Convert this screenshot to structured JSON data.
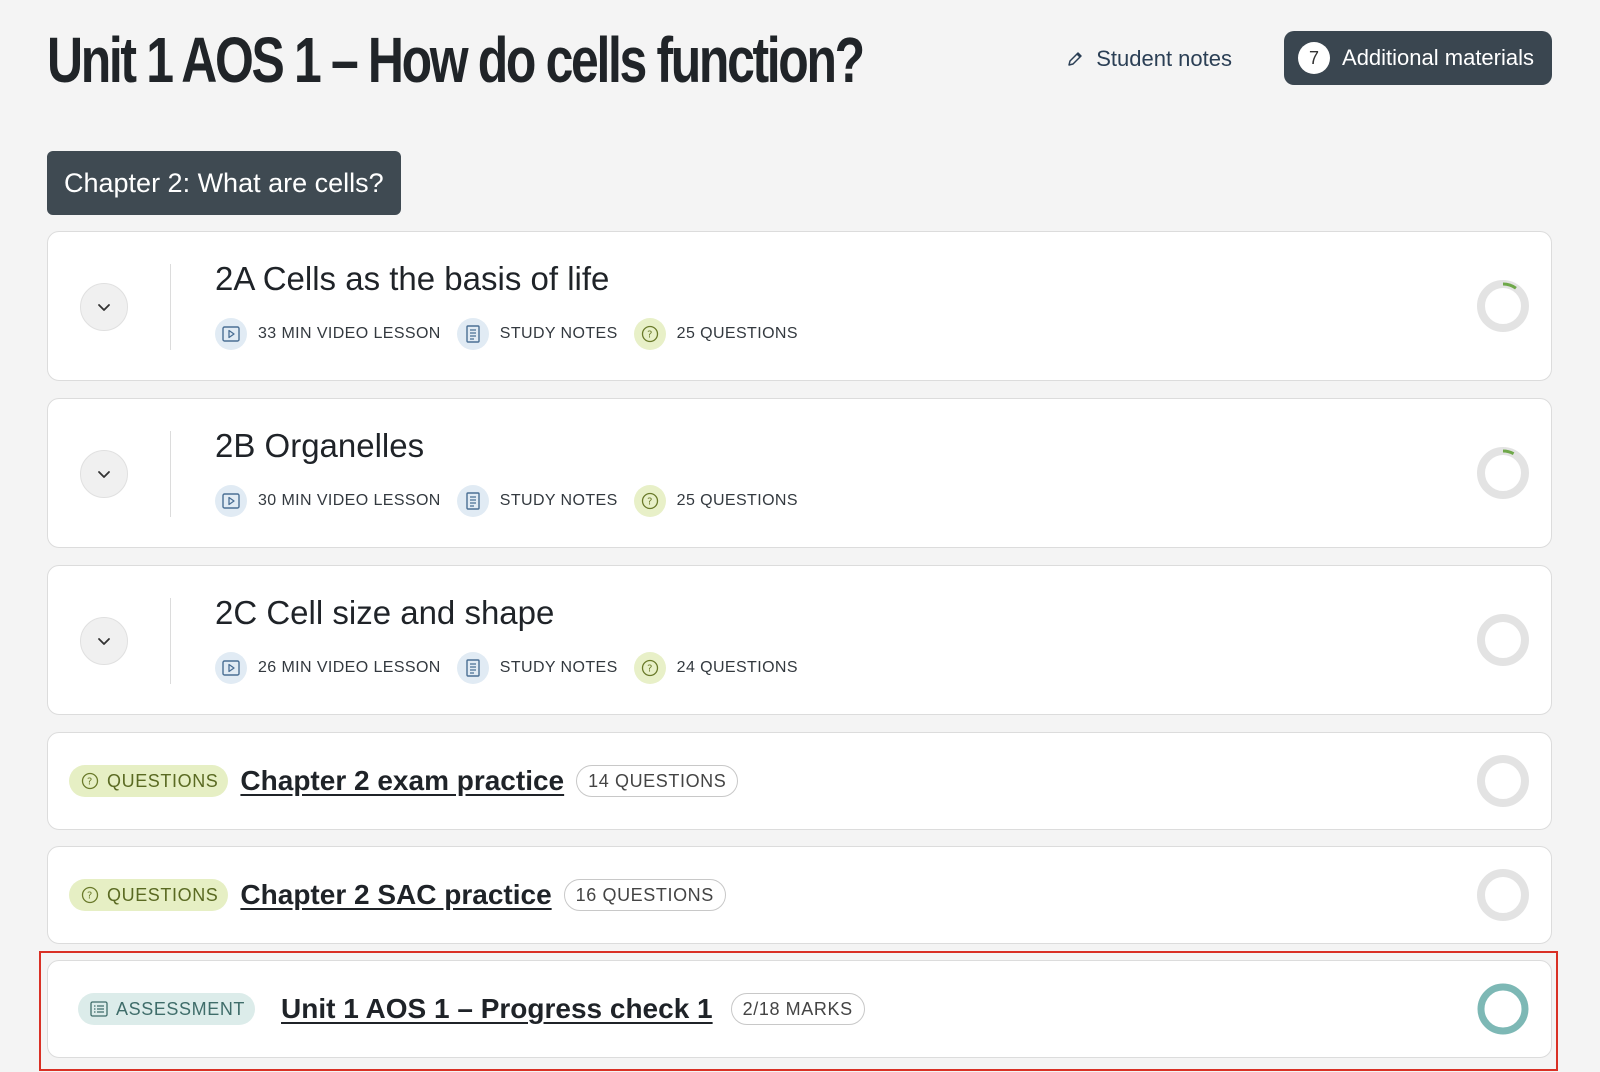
{
  "header": {
    "title": "Unit 1 AOS 1 – How do cells function?",
    "student_notes_label": "Student notes",
    "additional_materials_label": "Additional materials",
    "additional_materials_count": "7"
  },
  "chapter": {
    "label": "Chapter 2: What are cells?"
  },
  "lessons": [
    {
      "title": "2A Cells as the basis of life",
      "video": "33 MIN VIDEO LESSON",
      "notes": "STUDY NOTES",
      "questions": "25 QUESTIONS",
      "progress": 0.1
    },
    {
      "title": "2B Organelles",
      "video": "30 MIN VIDEO LESSON",
      "notes": "STUDY NOTES",
      "questions": "25 QUESTIONS",
      "progress": 0.08
    },
    {
      "title": "2C Cell size and shape",
      "video": "26 MIN VIDEO LESSON",
      "notes": "STUDY NOTES",
      "questions": "24 QUESTIONS",
      "progress": 0
    }
  ],
  "practice": [
    {
      "tag": "QUESTIONS",
      "title": "Chapter 2 exam practice",
      "count": "14 QUESTIONS"
    },
    {
      "tag": "QUESTIONS",
      "title": "Chapter 2 SAC practice",
      "count": "16 QUESTIONS"
    }
  ],
  "assessment": {
    "tag": "ASSESSMENT",
    "title": "Unit 1 AOS 1 – Progress check 1",
    "marks": "2/18 MARKS"
  },
  "colors": {
    "ring_track": "#e3e3e3",
    "ring_progress": "#6fa84a",
    "ring_complete": "#7db8b5",
    "highlight": "#d93025"
  }
}
